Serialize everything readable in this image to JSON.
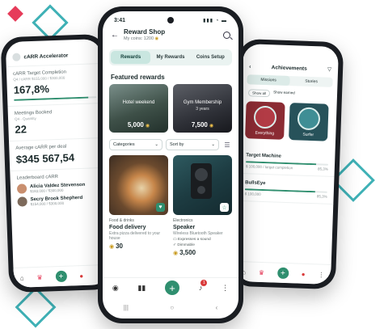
{
  "colors": {
    "teal": "#2f8f6f",
    "accent_pink": "#e63c5a",
    "diamond_teal": "#3fb1b6",
    "coin": "#c89a1e"
  },
  "left_phone": {
    "app_title": "cARR Accelerator",
    "target_label": "cARR Target Completion",
    "target_sub": "Q4 / cARR $155,000 / $300,000",
    "target_value": "167,8%",
    "target_progress": 0.9,
    "meetings_label": "Meetings Booked",
    "meetings_sub": "Q4 - Quantity",
    "meetings_value": "22",
    "average_label": "Average cARR per deal",
    "average_value": "$345 567,54",
    "leaderboard_label": "Leaderboard cARR",
    "leaderboard": [
      {
        "name": "Alicia Valdez Stevenson",
        "meta": "$183,000 / $300,000"
      },
      {
        "name": "Secry Brook Shepherd",
        "meta": "$154,000 / $300,000"
      }
    ],
    "nav_icons": [
      "home-icon",
      "trophy-icon",
      "add-icon",
      "bell-icon",
      "more-icon"
    ]
  },
  "center_phone": {
    "status_time": "3:41",
    "status_icons": "▮▮▮ ◔ ▬",
    "header_title": "Reward Shop",
    "header_sub_prefix": "My coins:",
    "header_coins": "1200",
    "tabs": [
      "Rewards",
      "My Rewards",
      "Coins Setup"
    ],
    "active_tab": 0,
    "section_title": "Featured rewards",
    "featured": [
      {
        "name": "Hotel weekend",
        "sub": "",
        "price": "5,000"
      },
      {
        "name": "Gym Membership",
        "sub": "3 years",
        "price": "7,500"
      }
    ],
    "filter_categories": "Categories",
    "filter_sort": "Sort by",
    "products": [
      {
        "category": "Food & drinks",
        "name": "Food delivery",
        "desc": "Extra pizza delivered to your house",
        "features": [],
        "price": "30"
      },
      {
        "category": "Electronics",
        "name": "Speaker",
        "desc": "Wireless Bluetooth Speaker",
        "features": [
          "Expresses a sound",
          "Dimmable"
        ],
        "price": "3,500"
      }
    ],
    "nav_badge": "1"
  },
  "right_phone": {
    "title": "Achievements",
    "tabs": [
      "Missions",
      "Stories"
    ],
    "filters": [
      "Show all",
      "Show earned"
    ],
    "badges": [
      "Everything",
      "Surfer"
    ],
    "rows": [
      {
        "name": "Target Machine",
        "meta_left": "$ 100,000 / target completion",
        "meta_right": "85,3%"
      },
      {
        "name": "BullsEye",
        "meta_left": "$ 100,000",
        "meta_right": "85,3%"
      }
    ]
  }
}
